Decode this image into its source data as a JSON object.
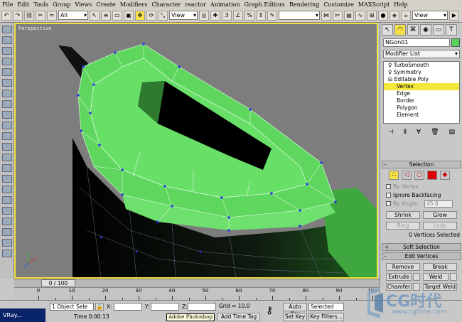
{
  "menu": [
    "File",
    "Edit",
    "Tools",
    "Group",
    "Views",
    "Create",
    "Modifiers",
    "Character",
    "reactor",
    "Animation",
    "Graph Editors",
    "Rendering",
    "Customize",
    "MAXScript",
    "Help"
  ],
  "toolbar": {
    "filter": "All",
    "ref_coord": "View",
    "ref_coord2": "View"
  },
  "viewport": {
    "label": "Perspective"
  },
  "panel": {
    "object_name": "NGon01",
    "object_color": "#5ad15a",
    "modifier_list": "Modifier List",
    "stack": [
      {
        "label": "TurboSmooth",
        "level": 0
      },
      {
        "label": "Symmetry",
        "level": 0
      },
      {
        "label": "Editable Poly",
        "level": 0
      },
      {
        "label": "Vertex",
        "level": 1,
        "highlight": true
      },
      {
        "label": "Edge",
        "level": 1
      },
      {
        "label": "Border",
        "level": 1
      },
      {
        "label": "Polygon",
        "level": 1
      },
      {
        "label": "Element",
        "level": 1
      }
    ],
    "selection": {
      "title": "Selection",
      "by_vertex": "By Vertex",
      "ignore_backfacing": "Ignore Backfacing",
      "by_angle": "By Angle:",
      "angle_value": "45.0",
      "shrink": "Shrink",
      "grow": "Grow",
      "ring": "Ring",
      "loop": "Loop",
      "status": "0 Vertices Selected"
    },
    "soft_selection": "Soft Selection",
    "edit_vertices": {
      "title": "Edit Vertices",
      "remove": "Remove",
      "break": "Break",
      "extrude": "Extrude",
      "weld": "Weld",
      "chamfer": "Chamfer",
      "target_weld": "Target Weld"
    }
  },
  "timeline": {
    "slider": "0 / 100",
    "ticks": [
      "0",
      "10",
      "20",
      "30",
      "40",
      "50",
      "60",
      "70",
      "80",
      "90",
      "100"
    ]
  },
  "status": {
    "selected": "1 Object Sele",
    "x_label": "X:",
    "y_label": "Y:",
    "z_label": "Z:",
    "grid": "Grid = 10.0",
    "add_time_tag": "Add Time Tag",
    "auto_key": "Auto Key",
    "set_key": "Set Key",
    "selected_dd": "Selected",
    "key_filters": "Key Filters...",
    "time": "Time  0:00:13"
  },
  "taskbar": {
    "item": "VRay...",
    "tooltip": "Adobe Photoshop"
  },
  "logo": {
    "text": "CG时代",
    "url": "www.cgtime.com"
  }
}
